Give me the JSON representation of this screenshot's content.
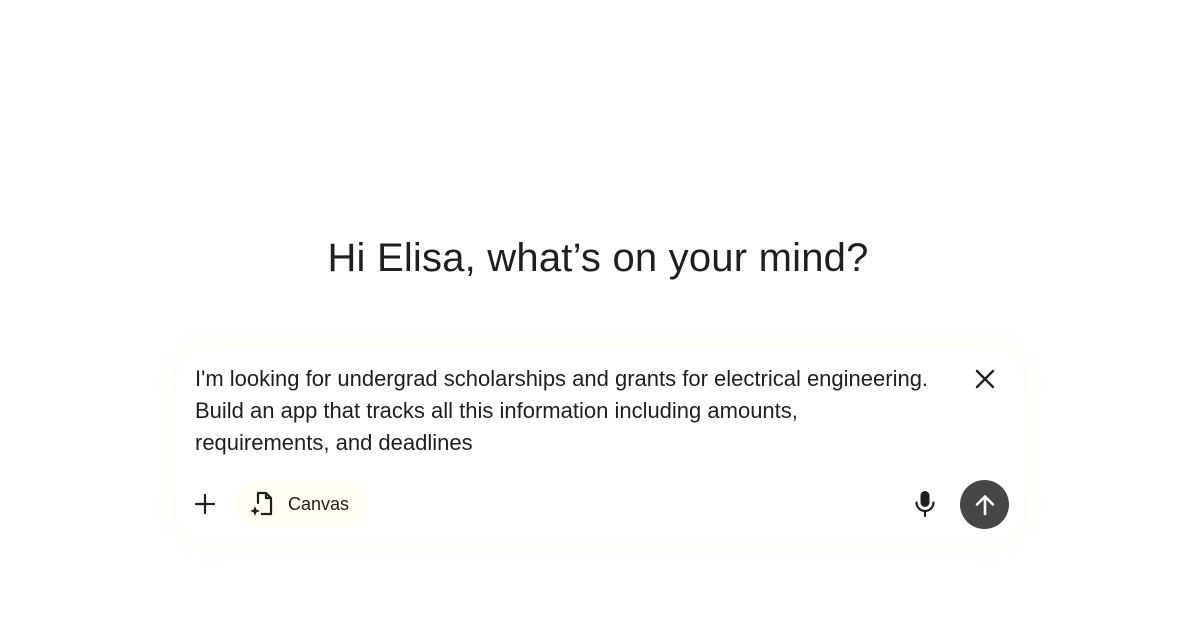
{
  "greeting": "Hi Elisa, what’s on your mind?",
  "composer": {
    "prompt_text": "I'm looking for undergrad scholarships and grants for electrical engineering.\nBuild an app that tracks all this information including amounts,\nrequirements, and deadlines",
    "clear_icon": "close-icon",
    "add_icon": "plus-icon",
    "tool_chip": {
      "label": "Canvas",
      "icon": "canvas-icon"
    },
    "mic_icon": "microphone-icon",
    "send_icon": "arrow-up-icon"
  },
  "colors": {
    "text": "#1f1f1f",
    "send_button_bg": "#444746",
    "chip_bg": "#fffdf2",
    "page_bg": "#ffffff"
  }
}
